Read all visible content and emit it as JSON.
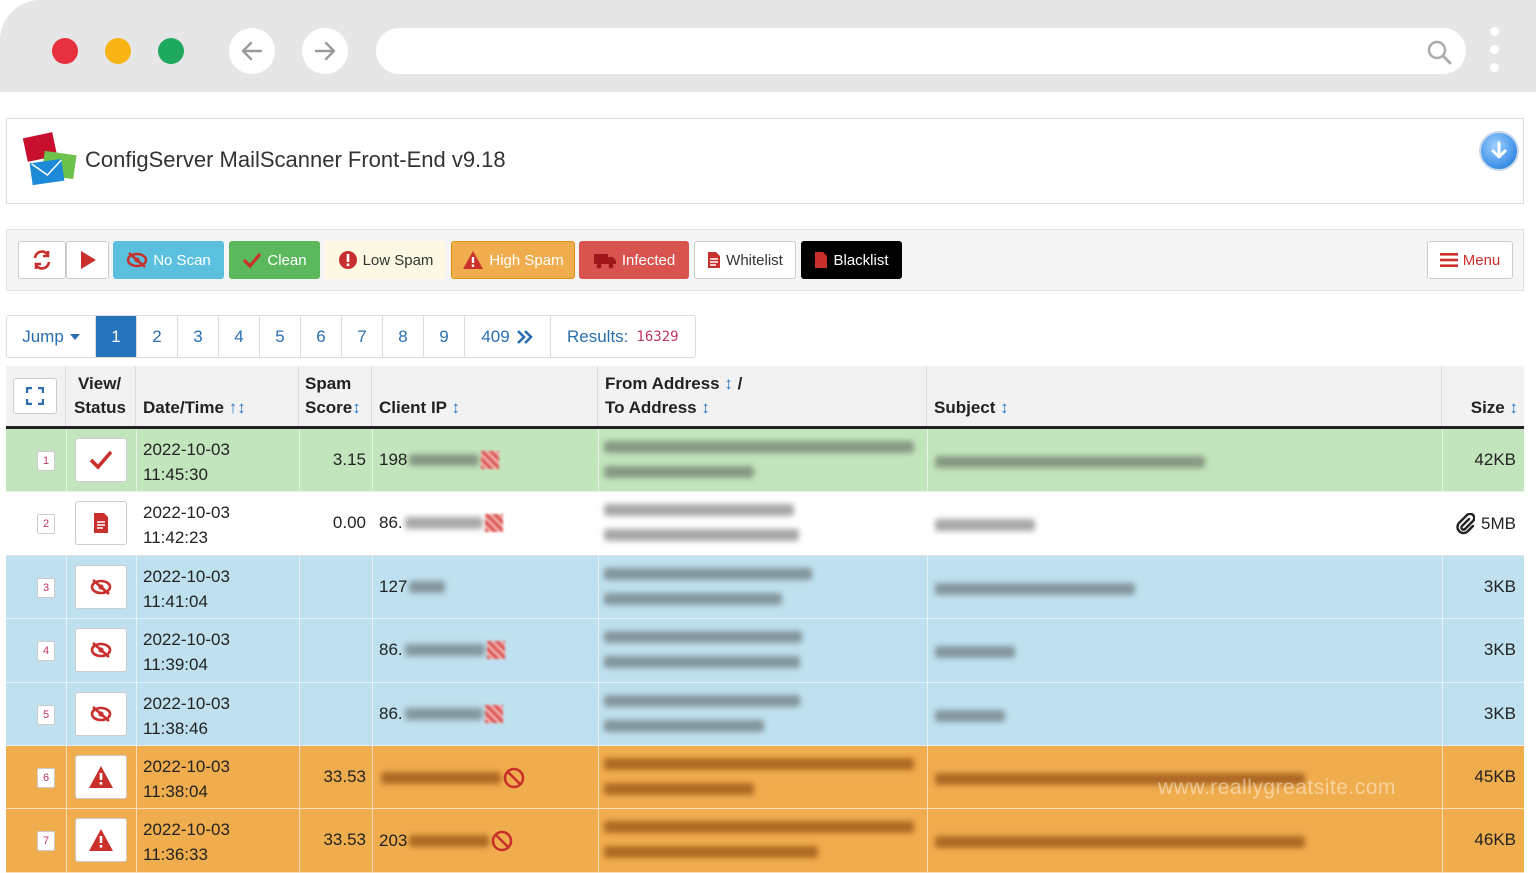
{
  "browser": {
    "search_icon": "search-icon",
    "back_icon": "arrow-left-icon",
    "forward_icon": "arrow-right-icon"
  },
  "app": {
    "title": "ConfigServer MailScanner Front-End v9.18"
  },
  "toolbar": {
    "no_scan": "No Scan",
    "clean": "Clean",
    "low_spam": "Low Spam",
    "high_spam": "High Spam",
    "infected": "Infected",
    "whitelist": "Whitelist",
    "blacklist": "Blacklist",
    "menu": "Menu"
  },
  "pagination": {
    "jump": "Jump",
    "pages": [
      "1",
      "2",
      "3",
      "4",
      "5",
      "6",
      "7",
      "8",
      "9"
    ],
    "last": "409",
    "results_label": "Results:",
    "results_count": "16329"
  },
  "table": {
    "headers": {
      "view_status_1": "View/",
      "view_status_2": "Status",
      "datetime": "Date/Time",
      "spam_1": "Spam",
      "spam_2": "Score",
      "client_ip": "Client IP",
      "from": "From Address",
      "from_sep": "/",
      "to": "To Address",
      "subject": "Subject",
      "size": "Size"
    },
    "rows": [
      {
        "n": "1",
        "date": "2022-10-03",
        "time": "11:45:30",
        "score": "3.15",
        "ip": "198",
        "size": "42KB",
        "status": "clean"
      },
      {
        "n": "2",
        "date": "2022-10-03",
        "time": "11:42:23",
        "score": "0.00",
        "ip": "86.",
        "size": "5MB",
        "status": "whitelist"
      },
      {
        "n": "3",
        "date": "2022-10-03",
        "time": "11:41:04",
        "score": "",
        "ip": "127",
        "size": "3KB",
        "status": "noscan"
      },
      {
        "n": "4",
        "date": "2022-10-03",
        "time": "11:39:04",
        "score": "",
        "ip": "86.",
        "size": "3KB",
        "status": "noscan"
      },
      {
        "n": "5",
        "date": "2022-10-03",
        "time": "11:38:46",
        "score": "",
        "ip": "86.",
        "size": "3KB",
        "status": "noscan"
      },
      {
        "n": "6",
        "date": "2022-10-03",
        "time": "11:38:04",
        "score": "33.53",
        "ip": "",
        "size": "45KB",
        "status": "highspam"
      },
      {
        "n": "7",
        "date": "2022-10-03",
        "time": "11:36:33",
        "score": "33.53",
        "ip": "203",
        "size": "46KB",
        "status": "highspam"
      }
    ]
  },
  "watermark": "www.reallygreatsite.com",
  "colors": {
    "clean_row": "#c3e5bd",
    "noscan_row": "#bfe0ef",
    "highspam_row": "#f0ad4e",
    "white_row": "#ffffff"
  }
}
